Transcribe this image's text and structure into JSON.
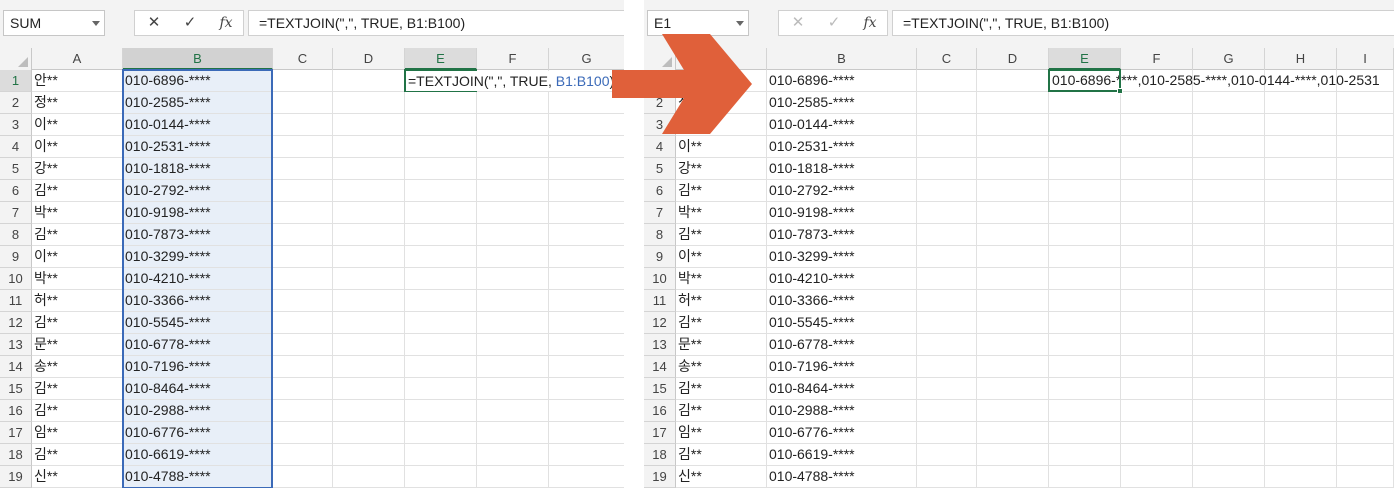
{
  "left": {
    "name_box": "SUM",
    "formula": "=TEXTJOIN(\",\", TRUE, B1:B100)",
    "cell_formula_prefix": "=TEXTJOIN(\",\", TRUE, ",
    "cell_formula_ref": "B1:B100",
    "cell_formula_suffix": ")",
    "columns": [
      "A",
      "B",
      "C",
      "D",
      "E",
      "F",
      "G"
    ],
    "active_column": "E",
    "range_column": "B",
    "active_row": "1"
  },
  "right": {
    "name_box": "E1",
    "formula": "=TEXTJOIN(\",\", TRUE, B1:B100)",
    "columns": [
      "A",
      "B",
      "C",
      "D",
      "E",
      "F",
      "G",
      "H",
      "I"
    ],
    "active_column": "E",
    "active_row": "1",
    "result_text": "010-6896-****,010-2585-****,010-0144-****,010-2531"
  },
  "icons": {
    "cancel": "✕",
    "enter": "✓",
    "fx": "fx"
  },
  "rows": [
    "1",
    "2",
    "3",
    "4",
    "5",
    "6",
    "7",
    "8",
    "9",
    "10",
    "11",
    "12",
    "13",
    "14",
    "15",
    "16",
    "17",
    "18",
    "19"
  ],
  "names": [
    "안**",
    "정**",
    "이**",
    "이**",
    "강**",
    "김**",
    "박**",
    "김**",
    "이**",
    "박**",
    "허**",
    "김**",
    "문**",
    "송**",
    "김**",
    "김**",
    "임**",
    "김**",
    "신**"
  ],
  "phones": [
    "010-6896-****",
    "010-2585-****",
    "010-0144-****",
    "010-2531-****",
    "010-1818-****",
    "010-2792-****",
    "010-9198-****",
    "010-7873-****",
    "010-3299-****",
    "010-4210-****",
    "010-3366-****",
    "010-5545-****",
    "010-6778-****",
    "010-7196-****",
    "010-8464-****",
    "010-2988-****",
    "010-6776-****",
    "010-6619-****",
    "010-4788-****"
  ],
  "colors": {
    "arrow": "#e0603a",
    "active_green": "#217346",
    "range_blue": "#3b6ab8"
  }
}
